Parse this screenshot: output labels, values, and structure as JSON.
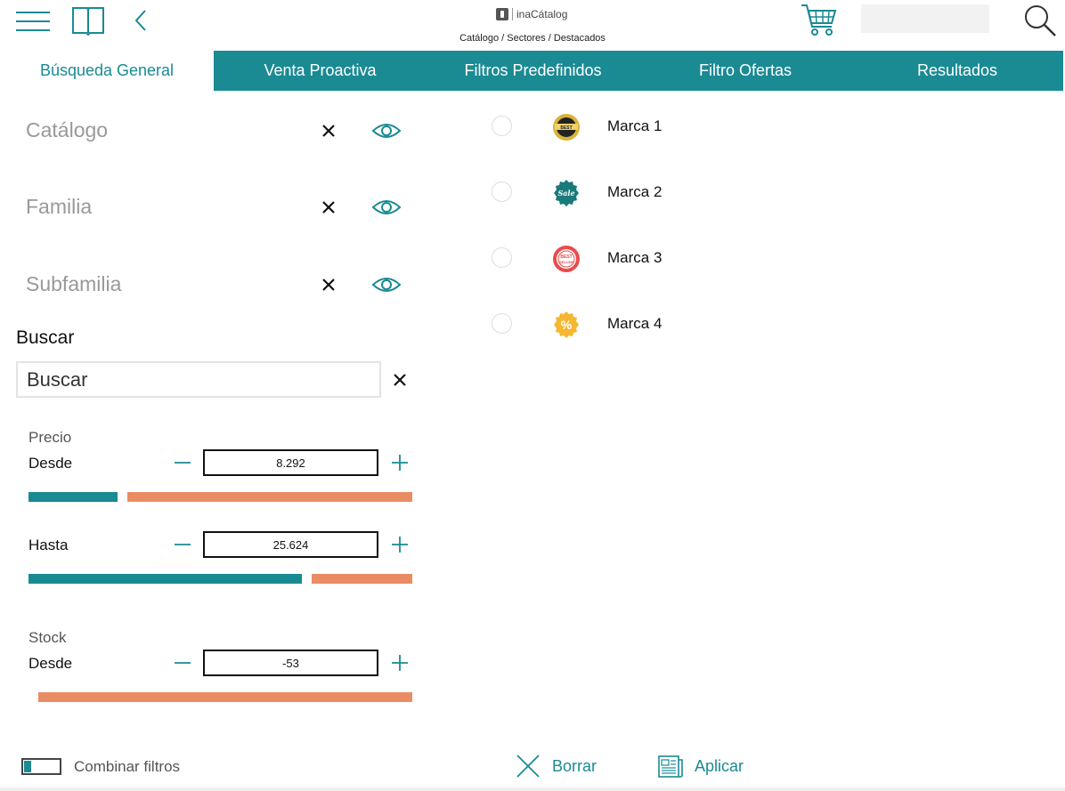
{
  "header": {
    "logo_text": "inaCátalog",
    "breadcrumb": "Catálogo / Sectores / Destacados",
    "search_value": ""
  },
  "tabs": [
    {
      "label": "Búsqueda General",
      "active": true
    },
    {
      "label": "Venta Proactiva",
      "active": false
    },
    {
      "label": "Filtros Predefinidos",
      "active": false
    },
    {
      "label": "Filtro Ofertas",
      "active": false
    },
    {
      "label": "Resultados",
      "active": false
    }
  ],
  "filters": [
    {
      "label": "Catálogo"
    },
    {
      "label": "Familia"
    },
    {
      "label": "Subfamilia"
    }
  ],
  "buscar": {
    "title": "Buscar",
    "placeholder": "Buscar"
  },
  "precio": {
    "label": "Precio",
    "desde_label": "Desde",
    "desde_value": "8.292",
    "desde_fraction": 0.232,
    "hasta_label": "Hasta",
    "hasta_value": "25.624",
    "hasta_fraction": 0.712
  },
  "stock": {
    "label": "Stock",
    "desde_label": "Desde",
    "desde_value": "-53",
    "desde_fraction": 0.0
  },
  "brands": [
    {
      "name": "Marca 1",
      "icon": "best-choice-badge-icon"
    },
    {
      "name": "Marca 2",
      "icon": "sale-badge-icon"
    },
    {
      "name": "Marca 3",
      "icon": "best-seller-badge-icon"
    },
    {
      "name": "Marca 4",
      "icon": "percent-badge-icon"
    }
  ],
  "footer": {
    "combine_label": "Combinar filtros",
    "borrar_label": "Borrar",
    "aplicar_label": "Aplicar"
  },
  "colors": {
    "accent": "#1a8a93",
    "slider_rest": "#e98c64"
  }
}
